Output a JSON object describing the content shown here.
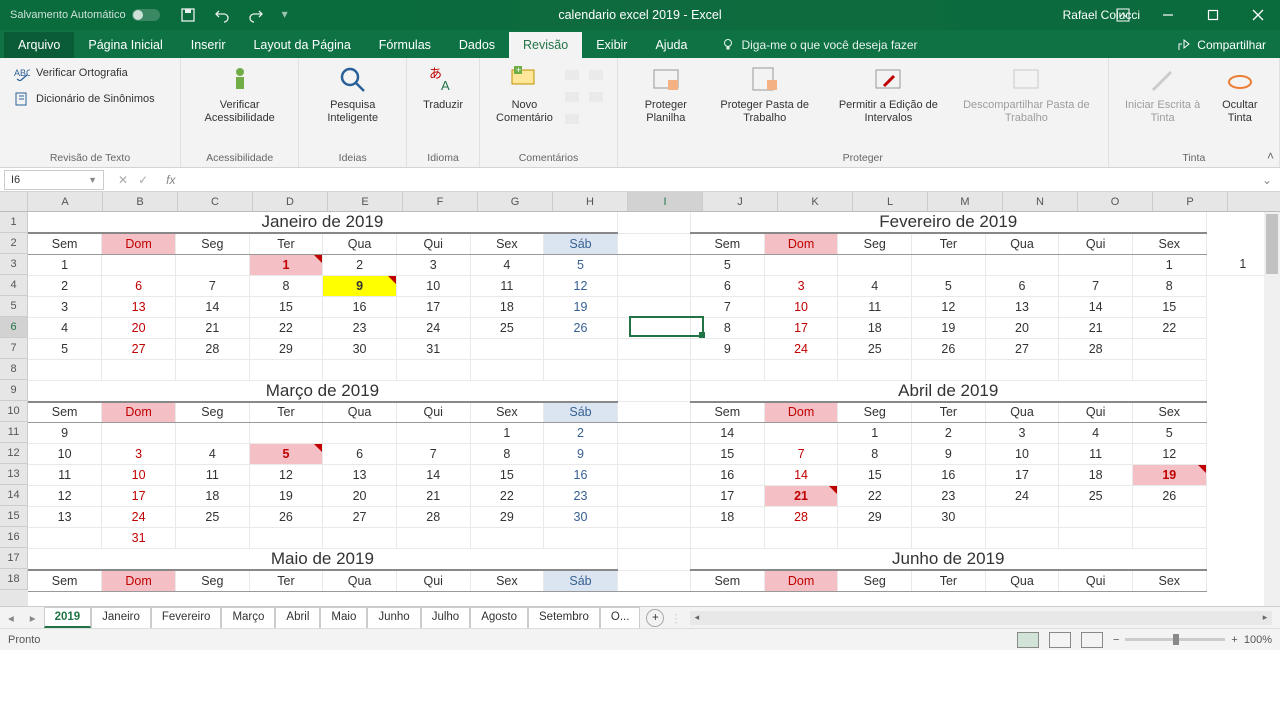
{
  "titlebar": {
    "autosave": "Salvamento Automático",
    "doc_title": "calendario excel 2019  -  Excel",
    "user": "Rafael Colucci"
  },
  "tabs": {
    "file": "Arquivo",
    "items": [
      "Página Inicial",
      "Inserir",
      "Layout da Página",
      "Fórmulas",
      "Dados",
      "Revisão",
      "Exibir",
      "Ajuda"
    ],
    "active_index": 5,
    "tellme": "Diga-me o que você deseja fazer",
    "share": "Compartilhar"
  },
  "ribbon": {
    "proofing": {
      "spell": "Verificar Ortografia",
      "thes": "Dicionário de Sinônimos",
      "label": "Revisão de Texto"
    },
    "access": {
      "btn": "Verificar Acessibilidade",
      "label": "Acessibilidade"
    },
    "insights": {
      "btn": "Pesquisa Inteligente",
      "label": "Ideias"
    },
    "lang": {
      "btn": "Traduzir",
      "label": "Idioma"
    },
    "comments": {
      "new": "Novo Comentário",
      "label": "Comentários"
    },
    "protect": {
      "sheet": "Proteger Planilha",
      "book": "Proteger Pasta de Trabalho",
      "ranges": "Permitir a Edição de Intervalos",
      "unshare": "Descompartilhar Pasta de Trabalho",
      "label": "Proteger"
    },
    "ink": {
      "start": "Iniciar Escrita à Tinta",
      "hide": "Ocultar Tinta",
      "label": "Tinta"
    }
  },
  "formula_bar": {
    "name": "I6",
    "formula": ""
  },
  "columns": [
    "A",
    "B",
    "C",
    "D",
    "E",
    "F",
    "G",
    "H",
    "I",
    "J",
    "K",
    "L",
    "M",
    "N",
    "O",
    "P"
  ],
  "selected_col_index": 8,
  "row_count": 18,
  "selected_row": 6,
  "cal": {
    "days": [
      "Sem",
      "Dom",
      "Seg",
      "Ter",
      "Qua",
      "Qui",
      "Sex",
      "Sáb"
    ],
    "days_right": [
      "Sem",
      "Dom",
      "Seg",
      "Ter",
      "Qua",
      "Qui",
      "Sex"
    ],
    "months": {
      "jan": {
        "title": "Janeiro de 2019",
        "rows": [
          [
            1,
            "",
            "",
            "1",
            "2",
            "3",
            "4",
            "5"
          ],
          [
            2,
            "6",
            "7",
            "8",
            "9",
            "10",
            "11",
            "12"
          ],
          [
            3,
            "13",
            "14",
            "15",
            "16",
            "17",
            "18",
            "19"
          ],
          [
            4,
            "20",
            "21",
            "22",
            "23",
            "24",
            "25",
            "26"
          ],
          [
            5,
            "27",
            "28",
            "29",
            "30",
            "31",
            "",
            ""
          ]
        ]
      },
      "fev": {
        "title": "Fevereiro de 2019",
        "rows": [
          [
            5,
            "",
            "",
            "",
            "",
            "",
            "1",
            "1"
          ],
          [
            6,
            "3",
            "4",
            "5",
            "6",
            "7",
            "8"
          ],
          [
            7,
            "10",
            "11",
            "12",
            "13",
            "14",
            "15"
          ],
          [
            8,
            "17",
            "18",
            "19",
            "20",
            "21",
            "22"
          ],
          [
            9,
            "24",
            "25",
            "26",
            "27",
            "28",
            ""
          ]
        ]
      },
      "mar": {
        "title": "Março de 2019",
        "rows": [
          [
            9,
            "",
            "",
            "",
            "",
            "",
            "1",
            "2"
          ],
          [
            10,
            "3",
            "4",
            "5",
            "6",
            "7",
            "8",
            "9"
          ],
          [
            11,
            "10",
            "11",
            "12",
            "13",
            "14",
            "15",
            "16"
          ],
          [
            12,
            "17",
            "18",
            "19",
            "20",
            "21",
            "22",
            "23"
          ],
          [
            13,
            "24",
            "25",
            "26",
            "27",
            "28",
            "29",
            "30"
          ],
          [
            "",
            "31",
            "",
            "",
            "",
            "",
            "",
            ""
          ]
        ]
      },
      "abr": {
        "title": "Abril de 2019",
        "rows": [
          [
            14,
            "",
            "1",
            "2",
            "3",
            "4",
            "5"
          ],
          [
            15,
            "7",
            "8",
            "9",
            "10",
            "11",
            "12"
          ],
          [
            16,
            "14",
            "15",
            "16",
            "17",
            "18",
            "19"
          ],
          [
            17,
            "21",
            "22",
            "23",
            "24",
            "25",
            "26"
          ],
          [
            18,
            "28",
            "29",
            "30",
            "",
            "",
            ""
          ]
        ]
      },
      "mai": {
        "title": "Maio de 2019"
      },
      "jun": {
        "title": "Junho de 2019"
      }
    }
  },
  "sheets": {
    "active": "2019",
    "list": [
      "2019",
      "Janeiro",
      "Fevereiro",
      "Março",
      "Abril",
      "Maio",
      "Junho",
      "Julho",
      "Agosto",
      "Setembro",
      "O..."
    ]
  },
  "status": {
    "ready": "Pronto",
    "zoom": "100%"
  }
}
